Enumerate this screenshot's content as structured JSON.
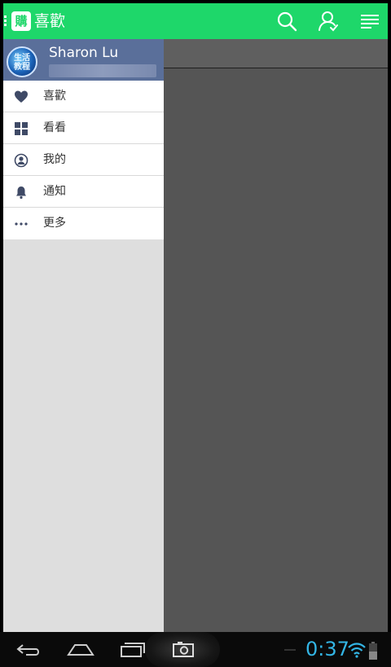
{
  "appbar": {
    "logo_glyph": "購",
    "title": "喜歡",
    "icons": [
      "search-icon",
      "user-icon",
      "menu-lines-icon"
    ],
    "accent_color": "#1ed76a"
  },
  "drawer": {
    "profile": {
      "name": "Sharon Lu",
      "avatar_text": "生活\n教程"
    },
    "items": [
      {
        "label": "喜歡",
        "icon": "heart-icon"
      },
      {
        "label": "看看",
        "icon": "grid-icon"
      },
      {
        "label": "我的",
        "icon": "profile-circle-icon"
      },
      {
        "label": "通知",
        "icon": "bell-icon"
      },
      {
        "label": "更多",
        "icon": "more-dots-icon"
      }
    ]
  },
  "statusbar": {
    "time": "0:37",
    "icons": [
      "back-icon",
      "home-icon",
      "recent-apps-icon",
      "camera-icon",
      "wifi-icon",
      "battery-icon"
    ]
  }
}
